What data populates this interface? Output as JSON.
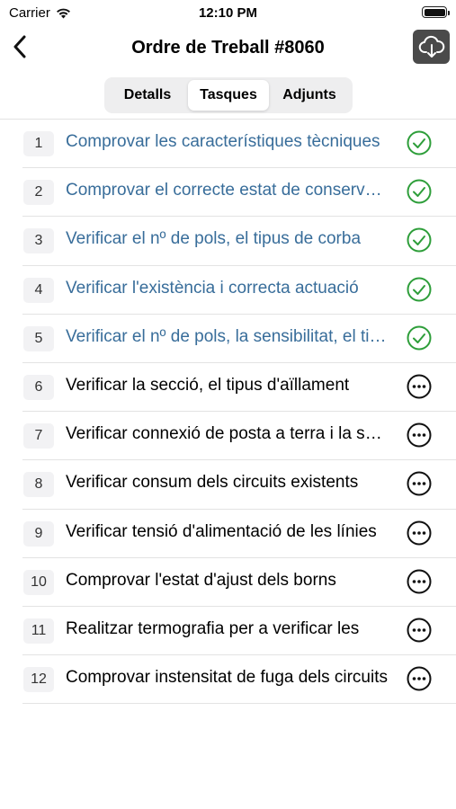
{
  "status_bar": {
    "carrier": "Carrier",
    "time": "12:10 PM"
  },
  "nav": {
    "title": "Ordre de Treball #8060"
  },
  "tabs": [
    {
      "label": "Detalls",
      "active": false
    },
    {
      "label": "Tasques",
      "active": true
    },
    {
      "label": "Adjunts",
      "active": false
    }
  ],
  "colors": {
    "done_text": "#386d9a",
    "done_icon": "#2e9e3a",
    "pending_icon": "#111111"
  },
  "tasks": [
    {
      "num": "1",
      "label": "Comprovar les característiques tècniques",
      "status": "done",
      "icon": "check-circle-icon"
    },
    {
      "num": "2",
      "label": "Comprovar el correcte estat de conservació",
      "status": "done",
      "icon": "check-circle-icon"
    },
    {
      "num": "3",
      "label": "Verificar el nº de pols, el tipus de corba",
      "status": "done",
      "icon": "check-circle-icon"
    },
    {
      "num": "4",
      "label": "Verificar l'existència i correcta actuació",
      "status": "done",
      "icon": "check-circle-icon"
    },
    {
      "num": "5",
      "label": "Verificar el nº de pols, la sensibilitat, el tipus",
      "status": "done",
      "icon": "check-circle-icon"
    },
    {
      "num": "6",
      "label": "Verificar la secció, el tipus d'aïllament",
      "status": "pending",
      "icon": "more-circle-icon"
    },
    {
      "num": "7",
      "label": "Verificar connexió de posta a terra i la seva",
      "status": "pending",
      "icon": "more-circle-icon"
    },
    {
      "num": "8",
      "label": "Verificar consum dels circuits existents",
      "status": "pending",
      "icon": "more-circle-icon"
    },
    {
      "num": "9",
      "label": "Verificar tensió d'alimentació de les línies",
      "status": "pending",
      "icon": "more-circle-icon"
    },
    {
      "num": "10",
      "label": "Comprovar l'estat d'ajust dels borns",
      "status": "pending",
      "icon": "more-circle-icon"
    },
    {
      "num": "11",
      "label": "Realitzar termografia per a verificar les",
      "status": "pending",
      "icon": "more-circle-icon"
    },
    {
      "num": "12",
      "label": "Comprovar instensitat de fuga dels circuits",
      "status": "pending",
      "icon": "more-circle-icon"
    }
  ]
}
